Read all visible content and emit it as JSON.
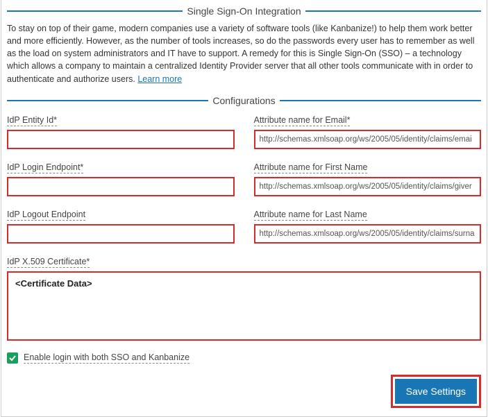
{
  "header": {
    "title": "Single Sign-On Integration"
  },
  "description": {
    "text": "To stay on top of their game, modern companies use a variety of software tools (like Kanbanize!) to help them work better and more efficiently. However, as the number of tools increases, so do the passwords every user has to remember as well as the load on system administrators and IT have to support. A remedy for this is Single Sign-On (SSO) – a technology which allows a company to maintain a centralized Identity Provider server that all other tools communicate with in order to authenticate and authorize users. ",
    "learn_more": "Learn more"
  },
  "config_header": "Configurations",
  "fields": {
    "idp_entity_id": {
      "label": "IdP Entity Id*",
      "value": ""
    },
    "attr_email": {
      "label": "Attribute name for Email*",
      "value": "http://schemas.xmlsoap.org/ws/2005/05/identity/claims/emai"
    },
    "idp_login": {
      "label": "IdP Login Endpoint*",
      "value": ""
    },
    "attr_first": {
      "label": "Attribute name for First Name",
      "value": "http://schemas.xmlsoap.org/ws/2005/05/identity/claims/giver"
    },
    "idp_logout": {
      "label": "IdP Logout Endpoint",
      "value": ""
    },
    "attr_last": {
      "label": "Attribute name for Last Name",
      "value": "http://schemas.xmlsoap.org/ws/2005/05/identity/claims/surna"
    },
    "cert": {
      "label": "IdP X.509 Certificate*",
      "value": "<Certificate Data>"
    }
  },
  "checkbox": {
    "label": "Enable login with both SSO and Kanbanize",
    "checked": true
  },
  "buttons": {
    "save": "Save Settings"
  }
}
